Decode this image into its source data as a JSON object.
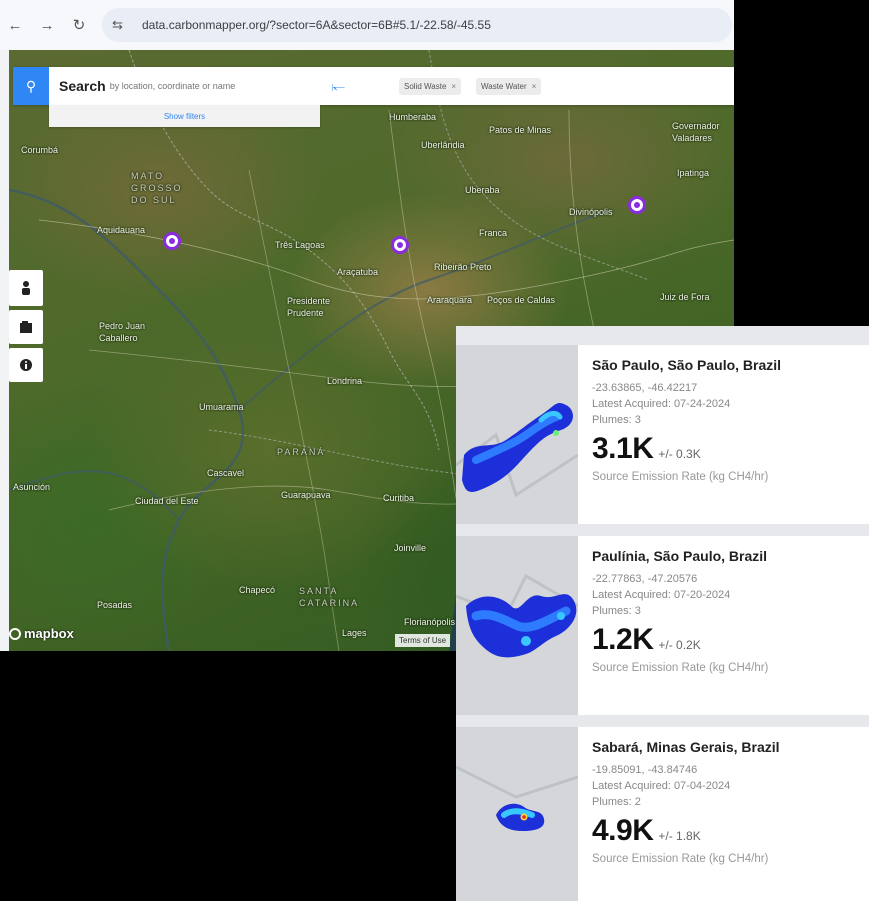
{
  "browser": {
    "url": "data.carbonmapper.org/?sector=6A&sector=6B#5.1/-22.58/-45.55",
    "back_icon": "arrow-left",
    "forward_icon": "arrow-right",
    "reload_icon": "reload",
    "site_settings_icon": "tune"
  },
  "search": {
    "title": "Search",
    "placeholder": "by location, coordinate or name",
    "show_filters": "Show filters",
    "chips": [
      {
        "label": "Solid Waste"
      },
      {
        "label": "Waste Water"
      }
    ]
  },
  "map": {
    "labels": [
      {
        "text": "Corumbá"
      },
      {
        "text": "Aquidauana"
      },
      {
        "text": "MATO GROSSO DO SUL"
      },
      {
        "text": "Três Lagoas"
      },
      {
        "text": "Araçatuba"
      },
      {
        "text": "Uberlândia"
      },
      {
        "text": "Patos de Minas"
      },
      {
        "text": "Humberaba"
      },
      {
        "text": "Uberaba"
      },
      {
        "text": "Franca"
      },
      {
        "text": "Ribeirão Preto"
      },
      {
        "text": "Araraquara"
      },
      {
        "text": "Poços de Caldas"
      },
      {
        "text": "Divinópolis"
      },
      {
        "text": "Ipatinga"
      },
      {
        "text": "Governador Valadares"
      },
      {
        "text": "Juiz de Fora"
      },
      {
        "text": "Presidente Prudente"
      },
      {
        "text": "Pedro Juan Caballero"
      },
      {
        "text": "Londrina"
      },
      {
        "text": "Umuarama"
      },
      {
        "text": "PARANÁ"
      },
      {
        "text": "Cascavel"
      },
      {
        "text": "Asunción"
      },
      {
        "text": "Ciudad del Este"
      },
      {
        "text": "Guarapuava"
      },
      {
        "text": "Curitiba"
      },
      {
        "text": "Joinville"
      },
      {
        "text": "Chapecó"
      },
      {
        "text": "SANTA CATARINA"
      },
      {
        "text": "Posadas"
      },
      {
        "text": "Lages"
      },
      {
        "text": "Florianópolis"
      }
    ],
    "attribution": "mapbox",
    "terms": "Terms of Use",
    "controls": [
      {
        "icon": "person-icon"
      },
      {
        "icon": "layers-icon"
      },
      {
        "icon": "info-icon"
      }
    ],
    "marker_color": "#8a2be2"
  },
  "detections": [
    {
      "location": "São Paulo, São Paulo, Brazil",
      "coords": "-23.63865, -46.42217",
      "acquired": "Latest Acquired: 07-24-2024",
      "plumes": "Plumes: 3",
      "rate": "3.1K",
      "uncertainty": "+/- 0.3K",
      "rate_label": "Source Emission Rate (kg CH4/hr)"
    },
    {
      "location": "Paulínia, São Paulo, Brazil",
      "coords": "-22.77863, -47.20576",
      "acquired": "Latest Acquired: 07-20-2024",
      "plumes": "Plumes: 3",
      "rate": "1.2K",
      "uncertainty": "+/- 0.2K",
      "rate_label": "Source Emission Rate (kg CH4/hr)"
    },
    {
      "location": "Sabará, Minas Gerais, Brazil",
      "coords": "-19.85091, -43.84746",
      "acquired": "Latest Acquired: 07-04-2024",
      "plumes": "Plumes: 2",
      "rate": "4.9K",
      "uncertainty": "+/- 1.8K",
      "rate_label": "Source Emission Rate (kg CH4/hr)"
    }
  ]
}
